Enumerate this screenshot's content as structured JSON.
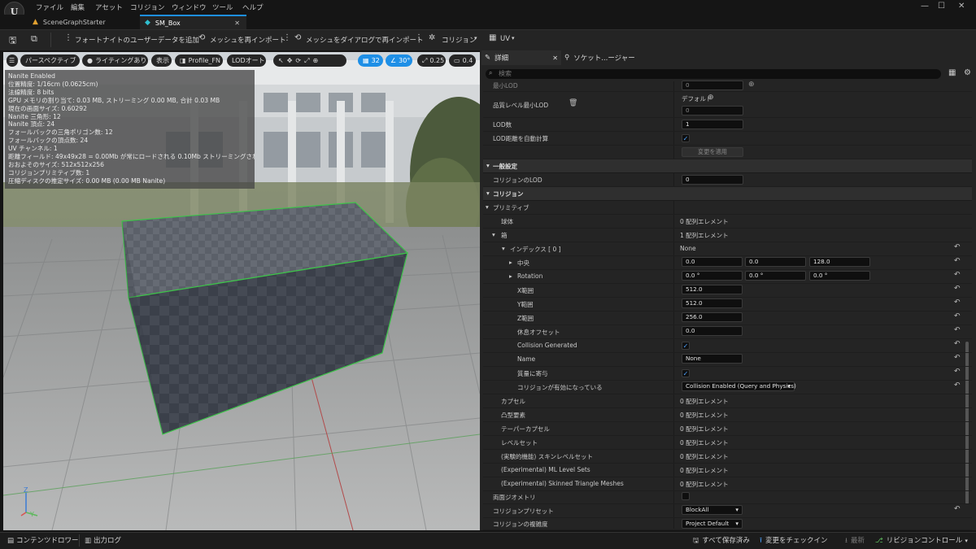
{
  "menu": [
    "ファイル",
    "編集",
    "アセット",
    "コリジョン",
    "ウィンドウ",
    "ツール",
    "ヘルプ"
  ],
  "tabs": [
    {
      "label": "SceneGraphStarter",
      "active": false
    },
    {
      "label": "SM_Box",
      "active": true
    }
  ],
  "toolbar": {
    "add_fortnite_user_data": "フォートナイトのユーザーデータを追加",
    "reimport_mesh": "メッシュを再インポート",
    "reimport_mesh_dialog": "メッシュをダイアログで再インポート",
    "collision": "コリジョン",
    "uv": "UV"
  },
  "viewport": {
    "perspective": "パースペクティブ",
    "lighting": "ライティングあり",
    "show": "表示",
    "profile": "Profile_FN",
    "lod": "LODオート",
    "grid_size": "32",
    "rotation_snap": "30°",
    "scale_snap": "0.25",
    "camera_speed": "0.4",
    "axis_z": "Z",
    "axis_y": "Y",
    "stats": [
      "Nanite Enabled",
      "位置精度: 1/16cm (0.0625cm)",
      "法線精度: 8 bits",
      "GPU メモリの割り当て: 0.03 MB, ストリーミング 0.00 MB, 合計 0.03 MB",
      "現在の画面サイズ: 0.60292",
      "Nanite 三角形: 12",
      "Nanite 頂点: 24",
      "フォールバックの三角ポリゴン数: 12",
      "フォールバックの頂点数: 24",
      "UV チャンネル: 1",
      "距離フィールド: 49x49x28 = 0.00Mb が常にロードされる 0.10Mb ストリーミングされる",
      "おおよそのサイズ: 512x512x256",
      "コリジョンプリミティブ数: 1",
      "圧縮ディスクの推定サイズ: 0.00 MB (0.00 MB Nanite)"
    ]
  },
  "panel_tabs": {
    "details": "詳細",
    "socket": "ソケット...ージャー"
  },
  "search_placeholder": "検索",
  "rows": {
    "min_lod": "最小LOD",
    "min_lod_val": "0",
    "quality_min_lod": "品質レベル最小LOD",
    "default_label": "デフォルト",
    "quality_min_lod_val": "0",
    "lod_count": "LOD数",
    "lod_count_val": "1",
    "auto_lod": "LOD距離を自動計算",
    "apply_changes": "変更を適用",
    "general_settings": "一般設定",
    "collision_lod": "コリジョンのLOD",
    "collision_lod_val": "0",
    "collision_section": "コリジョン",
    "primitives": "プリミティブ",
    "sphere": "球体",
    "sphere_val": "0 配列エレメント",
    "box": "箱",
    "box_val": "1 配列エレメント",
    "index": "インデックス [ 0 ]",
    "index_val": "None",
    "center": "中央",
    "center_x": "0.0",
    "center_y": "0.0",
    "center_z": "128.0",
    "rotation": "Rotation",
    "rot_x": "0.0 °",
    "rot_y": "0.0 °",
    "rot_z": "0.0 °",
    "x_extent": "X範囲",
    "x_extent_val": "512.0",
    "y_extent": "Y範囲",
    "y_extent_val": "512.0",
    "z_extent": "Z範囲",
    "z_extent_val": "256.0",
    "rest_offset": "休息オフセット",
    "rest_offset_val": "0.0",
    "collision_generated": "Collision Generated",
    "name": "Name",
    "name_val": "None",
    "contribute_mass": "質量に寄与",
    "collision_enabled": "コリジョンが有効になっている",
    "collision_enabled_val": "Collision Enabled (Query and Physics)",
    "capsule": "カプセル",
    "capsule_val": "0 配列エレメント",
    "convex": "凸型要素",
    "convex_val": "0 配列エレメント",
    "tapered_capsule": "テーパーカプセル",
    "tapered_capsule_val": "0 配列エレメント",
    "level_set": "レベルセット",
    "level_set_val": "0 配列エレメント",
    "skinned_level_set": "(実験的機能) スキンレベルセット",
    "skinned_level_set_val": "0 配列エレメント",
    "ml_level_sets": "(Experimental) ML Level Sets",
    "ml_level_sets_val": "0 配列エレメント",
    "skinned_triangle": "(Experimental) Skinned Triangle Meshes",
    "skinned_triangle_val": "0 配列エレメント",
    "double_sided": "両面ジオメトリ",
    "collision_preset": "コリジョンプリセット",
    "collision_preset_val": "BlockAll",
    "collision_complexity": "コリジョンの複雑度",
    "collision_complexity_val": "Project Default"
  },
  "bottom": {
    "content_drawer": "コンテンツドロワー",
    "output_log": "出力ログ",
    "save_all": "すべて保存済み",
    "check_in": "変更をチェックイン",
    "latest": "最新",
    "revision_control": "リビジョンコントロール"
  },
  "colors": {
    "accent": "#1e8fe6",
    "selection_outline": "#3ec24a",
    "checkbox": "#4da3ff"
  }
}
